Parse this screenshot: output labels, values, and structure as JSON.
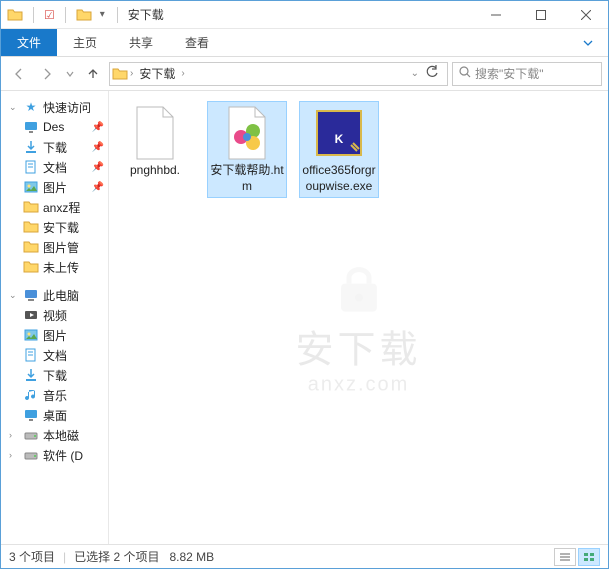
{
  "window": {
    "title": "安下载",
    "watermark_text": "安下载",
    "watermark_url": "anxz.com"
  },
  "ribbon": {
    "file": "文件",
    "home": "主页",
    "share": "共享",
    "view": "查看"
  },
  "addressbar": {
    "folder": "安下载"
  },
  "search": {
    "placeholder": "搜索\"安下载\""
  },
  "sidebar": {
    "quick_access": "快速访问",
    "items": [
      {
        "label": "Des",
        "pinned": true,
        "icon": "desktop"
      },
      {
        "label": "下载",
        "pinned": true,
        "icon": "download"
      },
      {
        "label": "文档",
        "pinned": true,
        "icon": "document"
      },
      {
        "label": "图片",
        "pinned": true,
        "icon": "picture"
      },
      {
        "label": "anxz程",
        "pinned": false,
        "icon": "folder"
      },
      {
        "label": "安下载",
        "pinned": false,
        "icon": "folder"
      },
      {
        "label": "图片管",
        "pinned": false,
        "icon": "folder"
      },
      {
        "label": "未上传",
        "pinned": false,
        "icon": "folder"
      }
    ],
    "this_pc": "此电脑",
    "pc_items": [
      {
        "label": "视频",
        "icon": "video"
      },
      {
        "label": "图片",
        "icon": "picture"
      },
      {
        "label": "文档",
        "icon": "document"
      },
      {
        "label": "下载",
        "icon": "download"
      },
      {
        "label": "音乐",
        "icon": "music"
      },
      {
        "label": "桌面",
        "icon": "desktop"
      },
      {
        "label": "本地磁",
        "icon": "drive"
      },
      {
        "label": "软件 (D",
        "icon": "drive"
      }
    ]
  },
  "files": [
    {
      "name": "pnghhbd.",
      "type": "blank",
      "selected": false
    },
    {
      "name": "安下载帮助.htm",
      "type": "htm",
      "selected": true
    },
    {
      "name": "office365forgroupwise.exe",
      "type": "k-exe",
      "selected": true
    }
  ],
  "status": {
    "count": "3 个项目",
    "selection": "已选择 2 个项目",
    "size": "8.82 MB"
  }
}
